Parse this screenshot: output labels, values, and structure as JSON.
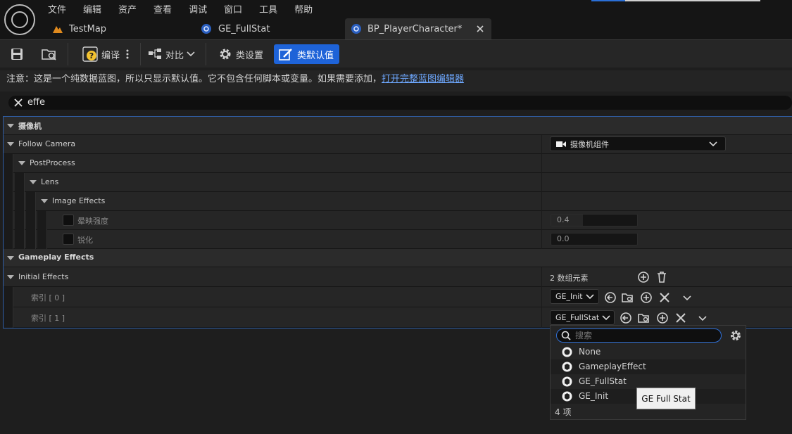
{
  "menu": [
    "文件",
    "编辑",
    "资产",
    "查看",
    "调试",
    "窗口",
    "工具",
    "帮助"
  ],
  "tabs": {
    "testmap": "TestMap",
    "ge_fullstat": "GE_FullStat",
    "bp_player": "BP_PlayerCharacter*"
  },
  "toolbar": {
    "compile": "编译",
    "diff": "对比",
    "class_settings": "类设置",
    "class_defaults": "类默认值"
  },
  "notice": {
    "text": "注意：这是一个纯数据蓝图，所以只显示默认值。它不包含任何脚本或变量。如果需要添加，",
    "link": "打开完整蓝图编辑器"
  },
  "search": {
    "value": "effe"
  },
  "details": {
    "camera_category": "摄像机",
    "follow_camera": "Follow Camera",
    "follow_camera_value": "摄像机组件",
    "postprocess": "PostProcess",
    "lens": "Lens",
    "image_effects": "Image Effects",
    "vignette_label": "晕映强度",
    "vignette_value": "0.4",
    "sharpen_label": "锐化",
    "sharpen_value": "0.0",
    "gameplay_category": "Gameplay Effects",
    "initial_effects": "Initial Effects",
    "array_count": "2 数组元素",
    "index0_label": "索引 [ 0 ]",
    "index0_value": "GE_Init",
    "index1_label": "索引 [ 1 ]",
    "index1_value": "GE_FullStat"
  },
  "popup": {
    "search_placeholder": "搜索",
    "items": [
      "None",
      "GameplayEffect",
      "GE_FullStat",
      "GE_Init"
    ],
    "count": "4 项",
    "tooltip": "GE Full Stat"
  },
  "colors": {
    "accent": "#1e63d8",
    "link": "#6ea8ff",
    "selection_border": "#2f5fa8"
  }
}
